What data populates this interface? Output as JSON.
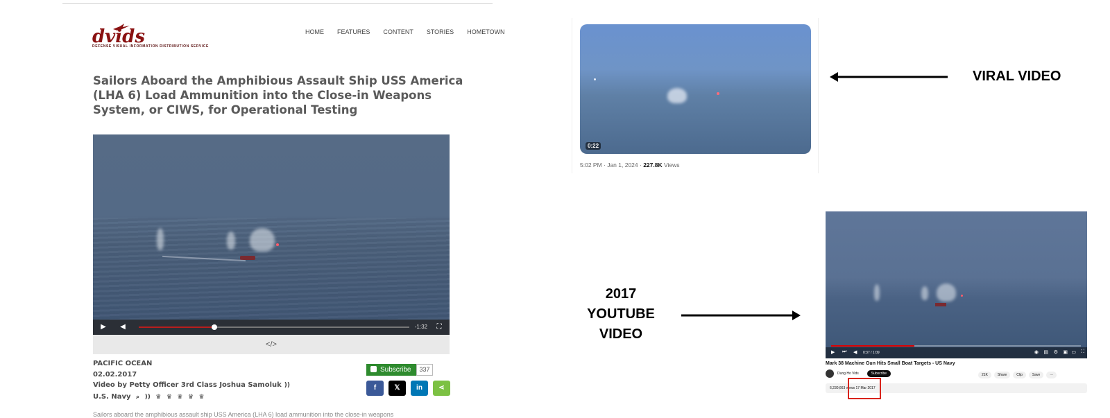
{
  "dvids": {
    "logo_text": "dvids",
    "logo_subtitle": "DEFENSE VISUAL INFORMATION DISTRIBUTION SERVICE",
    "nav": [
      "HOME",
      "FEATURES",
      "CONTENT",
      "STORIES",
      "HOMETOWN"
    ],
    "headline": "Sailors Aboard the Amphibious Assault Ship USS America (LHA 6) Load Ammunition into the Close-in Weapons System, or CIWS, for Operational Testing",
    "player": {
      "time_remaining": "-1:32",
      "progress": 0.28,
      "embed_icon": "</>"
    },
    "location": "PACIFIC OCEAN",
    "date": "02.02.2017",
    "byline": "Video by Petty Officer 3rd Class Joshua Samoluk",
    "branch": "U.S. Navy",
    "subscribe_label": "Subscribe",
    "subscriber_count": "337",
    "share_buttons": [
      {
        "name": "facebook",
        "glyph": "f",
        "color": "#3b5998"
      },
      {
        "name": "x",
        "glyph": "𝕏",
        "color": "#000000"
      },
      {
        "name": "linkedin",
        "glyph": "in",
        "color": "#0077b5"
      },
      {
        "name": "share",
        "glyph": "⋖",
        "color": "#7cc143"
      }
    ],
    "body_cutoff": "Sailors aboard the amphibious assault ship USS America (LHA 6) load ammunition into the close-in weapons"
  },
  "tweet": {
    "duration": "0:22",
    "timestamp": "5:02 PM · Jan 1, 2024 · ",
    "views_count": "227.8K",
    "views_label": " Views"
  },
  "annotations": {
    "viral_label": "VIRAL VIDEO",
    "youtube_label_lines": [
      "2017",
      "YOUTUBE",
      "VIDEO"
    ],
    "highlight_color": "#d9241c"
  },
  "youtube": {
    "title": "Mark 38 Machine Gun Hits Small Boat Targets - US Navy",
    "channel": "Dung Ho Vids",
    "subscribe_label": "Subscribe",
    "time": "0:37 / 1:09",
    "actions": [
      "21K",
      "Share",
      "Clip",
      "Save",
      "···"
    ],
    "views_date": "6,230,663 views  17 Mar 2017"
  }
}
